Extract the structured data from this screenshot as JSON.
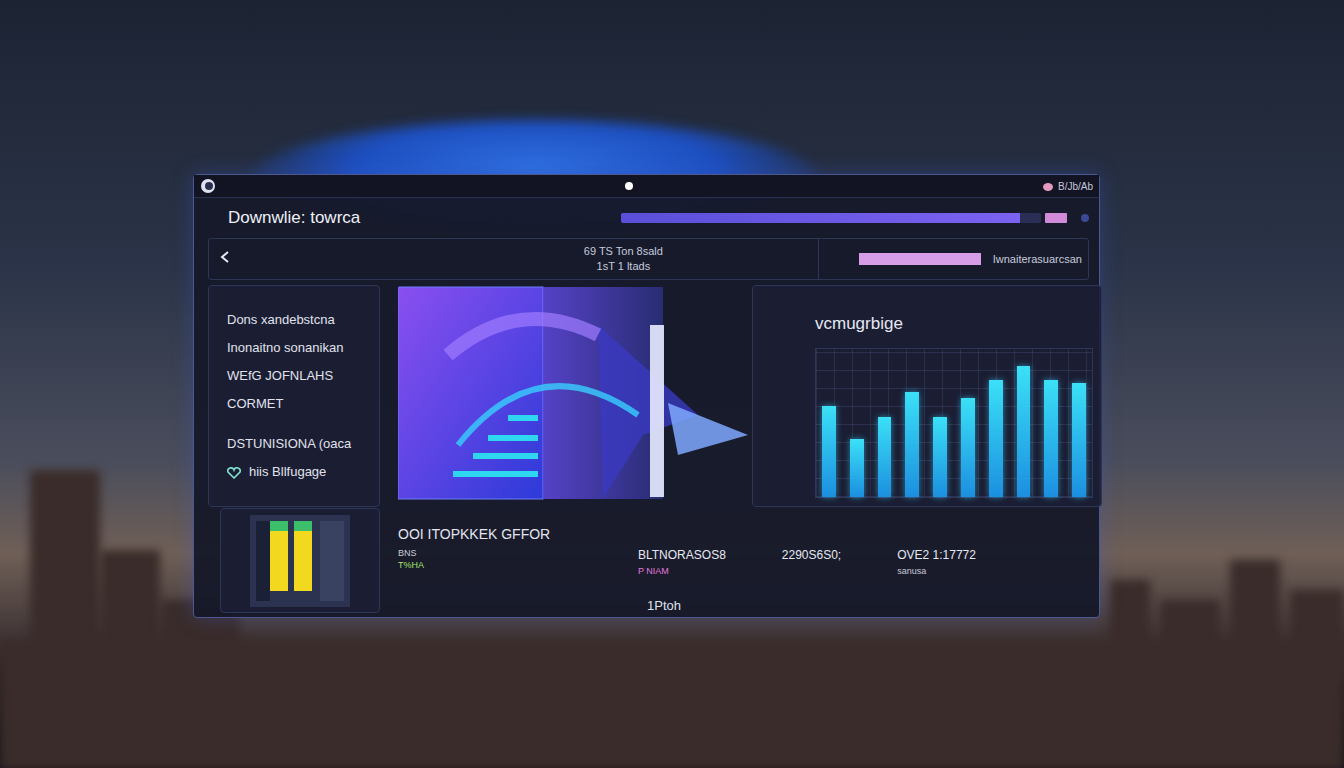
{
  "window": {
    "title": "Downwlie: towrca",
    "status": "B/Jb/Ab"
  },
  "header": {
    "progress": {
      "level": 0.95
    }
  },
  "toolbar": {
    "info": [
      "69 TS   Ton 8sald",
      "1sT   1 ltads"
    ],
    "meter": {
      "level": 1.0
    },
    "label": "Iwnaiterasuarcsan"
  },
  "details": {
    "lines": [
      "Dons xandebstcna",
      "Inonaitno sonanikan",
      "WEfG JOFNLAHS",
      "CORMET"
    ],
    "meta": [
      {
        "text": "DSTUNISIONA (oaca",
        "kind": "text"
      },
      {
        "text": "hiis Bllfugage",
        "kind": "icon"
      }
    ]
  },
  "chart": {
    "title": "vcmugrbige",
    "series": [
      {
        "values": [
          62,
          40,
          55,
          72,
          55,
          68,
          80,
          90,
          80,
          78
        ]
      }
    ]
  },
  "summary": {
    "title": "OOI ITOPKKEK GFFOR",
    "caption": "BNS",
    "tag": "T%HA",
    "progress": {
      "level": 0.12
    },
    "stats": [
      {
        "value": "BLTNORASOS8",
        "sub": "P NIAM",
        "kind": "tagged"
      },
      {
        "value": "2290S6S0;",
        "kind": "plain"
      },
      {
        "value": "OVE2 1:17772",
        "sub": "sanusa",
        "kind": "captioned"
      }
    ],
    "footer": "1Ptoh"
  }
}
